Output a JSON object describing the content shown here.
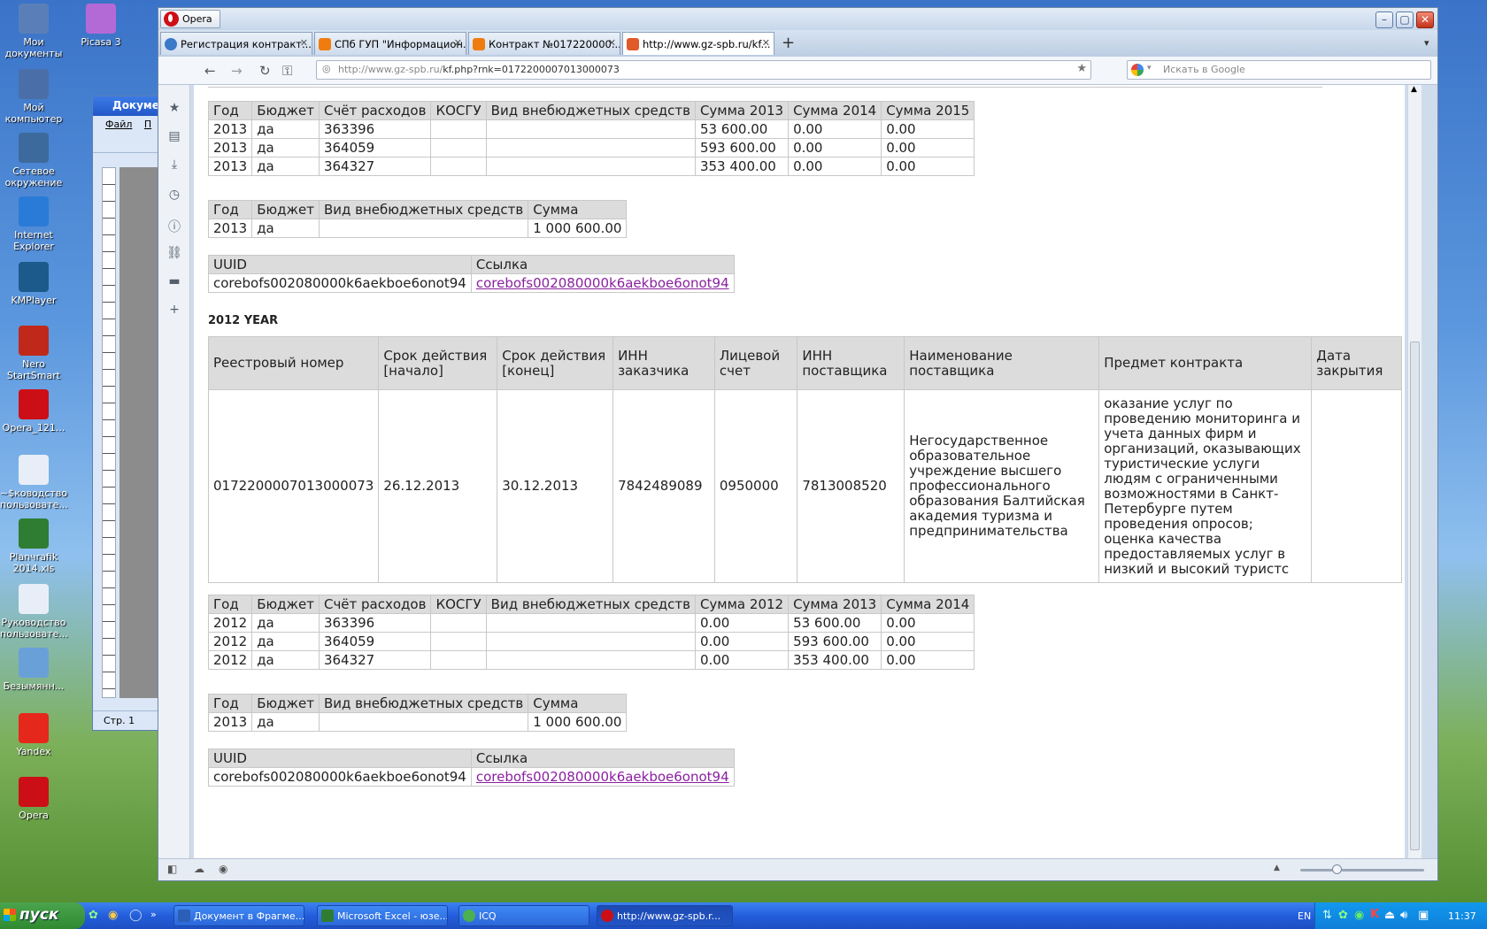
{
  "desktop_icons": [
    {
      "label": "Мои документы",
      "icon": "my-documents-icon",
      "color": "#5a7fb8"
    },
    {
      "label": "Мой компьютер",
      "icon": "my-computer-icon",
      "color": "#4a6fa8"
    },
    {
      "label": "Сетевое окружение",
      "icon": "network-icon",
      "color": "#3d6a9c"
    },
    {
      "label": "Internet Explorer",
      "icon": "ie-icon",
      "color": "#2a7ad8"
    },
    {
      "label": "KMPlayer",
      "icon": "kmplayer-icon",
      "color": "#1b5a8a"
    },
    {
      "label": "Nero StartSmart",
      "icon": "nero-icon",
      "color": "#c0291a"
    },
    {
      "label": "Opera_121...",
      "icon": "opera-installer-icon",
      "color": "#cc0f16"
    },
    {
      "label": "~$ководство пользовате...",
      "icon": "word-doc-icon",
      "color": "#e8eef7"
    },
    {
      "label": "Planчrafik 2014.xls",
      "icon": "excel-icon",
      "color": "#2e7d32"
    },
    {
      "label": "Руководство пользовате...",
      "icon": "word-doc-icon",
      "color": "#e8eef7"
    },
    {
      "label": "Безымянн...",
      "icon": "image-icon",
      "color": "#6aa0d8"
    },
    {
      "label": "Yandex",
      "icon": "yandex-icon",
      "color": "#e6271b"
    },
    {
      "label": "Opera",
      "icon": "opera-icon",
      "color": "#cc0f16"
    },
    {
      "label": "Picasa 3",
      "icon": "picasa-icon",
      "color": "#b46ad6"
    }
  ],
  "word_window": {
    "title": "Докуме",
    "menu": [
      "Файл",
      "П"
    ],
    "status": "Стр. 1"
  },
  "browser": {
    "app_button": "Opera",
    "tabs": [
      {
        "label": "Регистрация контракт...",
        "favicon_color": "#3b79c9"
      },
      {
        "label": "СПб ГУП \"Информацион...",
        "favicon_color": "#f07c10"
      },
      {
        "label": "Контракт №017220000...",
        "favicon_color": "#f07c10"
      },
      {
        "label": "http://www.gz-spb.ru/kf...",
        "favicon_color": "#e05a2a"
      }
    ],
    "url_prefix": "http://www.gz-spb.ru/",
    "url_rest": "kf.php?rnk=0172200007013000073",
    "search_placeholder": "Искать в Google"
  },
  "section_2013": {
    "finance_table": {
      "headers": [
        "Год",
        "Бюджет",
        "Счёт расходов",
        "КОСГУ",
        "Вид внебюджетных средств",
        "Сумма 2013",
        "Сумма 2014",
        "Сумма 2015"
      ],
      "rows": [
        [
          "2013",
          "да",
          "363396",
          "",
          "",
          "53 600.00",
          "0.00",
          "0.00"
        ],
        [
          "2013",
          "да",
          "364059",
          "",
          "",
          "593 600.00",
          "0.00",
          "0.00"
        ],
        [
          "2013",
          "да",
          "364327",
          "",
          "",
          "353 400.00",
          "0.00",
          "0.00"
        ]
      ]
    },
    "sum_table": {
      "headers": [
        "Год",
        "Бюджет",
        "Вид внебюджетных средств",
        "Сумма"
      ],
      "rows": [
        [
          "2013",
          "да",
          "",
          "1 000 600.00"
        ]
      ]
    },
    "uuid_table": {
      "headers": [
        "UUID",
        "Ссылка"
      ],
      "uuid": "corebofs002080000k6aekboe6onot94",
      "link": "corebofs002080000k6aekboe6onot94"
    }
  },
  "section_2012": {
    "year_heading": "2012 YEAR",
    "contract_table": {
      "headers": [
        "Реестровый номер",
        "Срок действия [начало]",
        "Срок действия [конец]",
        "ИНН заказчика",
        "Лицевой счет",
        "ИНН поставщика",
        "Наименование поставщика",
        "Предмет контракта",
        "Дата закрытия"
      ],
      "row": [
        "0172200007013000073",
        "26.12.2013",
        "30.12.2013",
        "7842489089",
        "0950000",
        "7813008520",
        "Негосударственное образовательное учреждение высшего профессионального образования Балтийская академия туризма и предпринимательства",
        "оказание услуг по проведению мониторинга и учета данных фирм и организаций, оказывающих туристические услуги людям с ограниченными возможностями в Санкт-Петербурге путем проведения опросов; оценка качества предоставляемых услуг в низкий и высокий туристс",
        ""
      ]
    },
    "finance_table": {
      "headers": [
        "Год",
        "Бюджет",
        "Счёт расходов",
        "КОСГУ",
        "Вид внебюджетных средств",
        "Сумма 2012",
        "Сумма 2013",
        "Сумма 2014"
      ],
      "rows": [
        [
          "2012",
          "да",
          "363396",
          "",
          "",
          "0.00",
          "53 600.00",
          "0.00"
        ],
        [
          "2012",
          "да",
          "364059",
          "",
          "",
          "0.00",
          "593 600.00",
          "0.00"
        ],
        [
          "2012",
          "да",
          "364327",
          "",
          "",
          "0.00",
          "353 400.00",
          "0.00"
        ]
      ]
    },
    "sum_table": {
      "headers": [
        "Год",
        "Бюджет",
        "Вид внебюджетных средств",
        "Сумма"
      ],
      "rows": [
        [
          "2013",
          "да",
          "",
          "1 000 600.00"
        ]
      ]
    },
    "uuid_table": {
      "headers": [
        "UUID",
        "Ссылка"
      ],
      "uuid": "corebofs002080000k6aekboe6onot94",
      "link": "corebofs002080000k6aekboe6onot94"
    }
  },
  "taskbar": {
    "start": "пуск",
    "tasks": [
      {
        "label": "Документ в Фрагме...",
        "icon_color": "#2b5fb8"
      },
      {
        "label": "Microsoft Excel - юзе...",
        "icon_color": "#2e7d32"
      },
      {
        "label": "ICQ",
        "icon_color": "#4caf50"
      },
      {
        "label": "http://www.gz-spb.r...",
        "icon_color": "#cc0f16"
      }
    ],
    "lang": "EN",
    "clock": "11:37"
  }
}
